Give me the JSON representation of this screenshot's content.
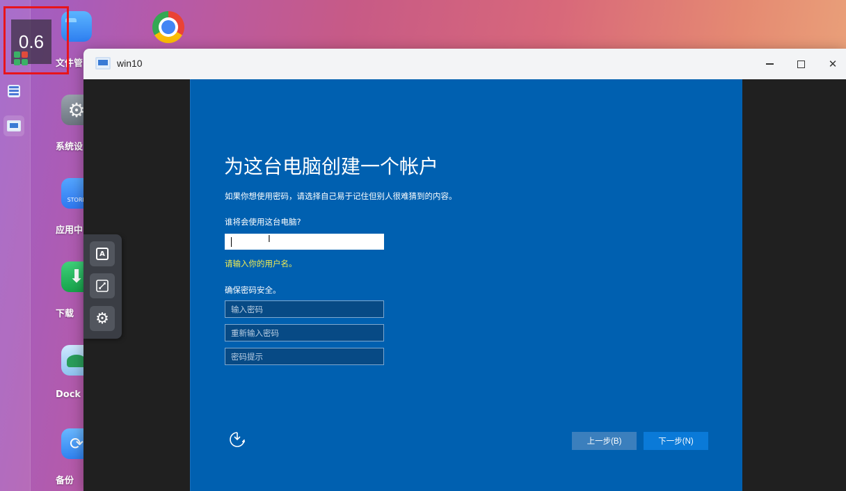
{
  "zoom_indicator": {
    "value": "0.6"
  },
  "desktop": {
    "icons": [
      {
        "label": "文件管",
        "icon": "folder-icon"
      },
      {
        "label": "系统设",
        "icon": "settings-icon"
      },
      {
        "label": "应用中",
        "icon": "store-icon",
        "badge": "STORE"
      },
      {
        "label": "下载",
        "icon": "download-icon"
      },
      {
        "label": "Dock",
        "icon": "docker-icon"
      },
      {
        "label": "备份",
        "icon": "backup-icon"
      }
    ],
    "chrome": "chrome-icon"
  },
  "window": {
    "title": "win10",
    "controls": {
      "minimize": "−",
      "maximize": "☐",
      "close": "✕"
    }
  },
  "oobe": {
    "title": "为这台电脑创建一个帐户",
    "subtitle": "如果你想使用密码，请选择自己易于记住但别人很难猜到的内容。",
    "username_label": "谁将会使用这台电脑?",
    "username_value": "",
    "username_hint": "请输入你的用户名。",
    "password_section_label": "确保密码安全。",
    "password_placeholder": "输入密码",
    "confirm_placeholder": "重新输入密码",
    "hint_placeholder": "密码提示",
    "back_button": "上一步(B)",
    "next_button": "下一步(N)"
  },
  "floating_toolbar": {
    "items": [
      "keyboard-icon",
      "fullscreen-icon",
      "settings-icon"
    ]
  },
  "colors": {
    "oobe_background": "#0060b0",
    "hint_text": "#f2ec53",
    "next_button": "#0a7ad8",
    "back_button": "#3b7fbd"
  }
}
